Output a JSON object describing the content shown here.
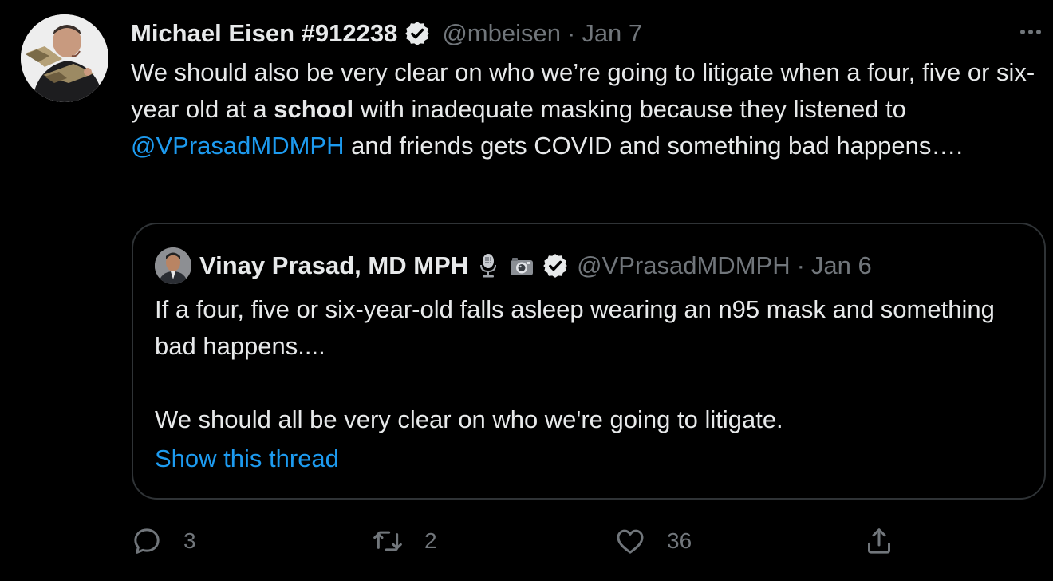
{
  "tweet": {
    "author_name": "Michael Eisen #912238",
    "handle": "@mbeisen",
    "separator": "·",
    "date": "Jan 7",
    "text_before_bold": "We should also be very clear on who we’re going to litigate when a four, five or six-year old at a ",
    "text_bold": "school",
    "text_after_bold": " with inadequate masking because they listened to ",
    "mention": "@VPrasadMDMPH",
    "text_end": " and friends gets COVID and something bad happens…."
  },
  "quoted_tweet": {
    "author_name": "Vinay Prasad, MD MPH",
    "handle": "@VPrasadMDMPH",
    "separator": "·",
    "date": "Jan 6",
    "paragraph_1": "If a four, five or six-year-old falls asleep wearing an n95 mask and something bad happens....",
    "paragraph_2": "We should all be very clear on who we're going to litigate.",
    "show_thread": "Show this thread"
  },
  "actions": {
    "reply_count": "3",
    "retweet_count": "2",
    "like_count": "36"
  },
  "icons": {
    "verified": "verified-badge-icon",
    "more": "more-icon",
    "reply": "reply-icon",
    "retweet": "retweet-icon",
    "like": "like-icon",
    "share": "share-icon",
    "microphone": "microphone-icon",
    "camera": "camera-icon"
  },
  "colors": {
    "background": "#000000",
    "text": "#e7e9ea",
    "secondary": "#71767b",
    "link": "#1d9bf0",
    "border": "#2f3336"
  }
}
